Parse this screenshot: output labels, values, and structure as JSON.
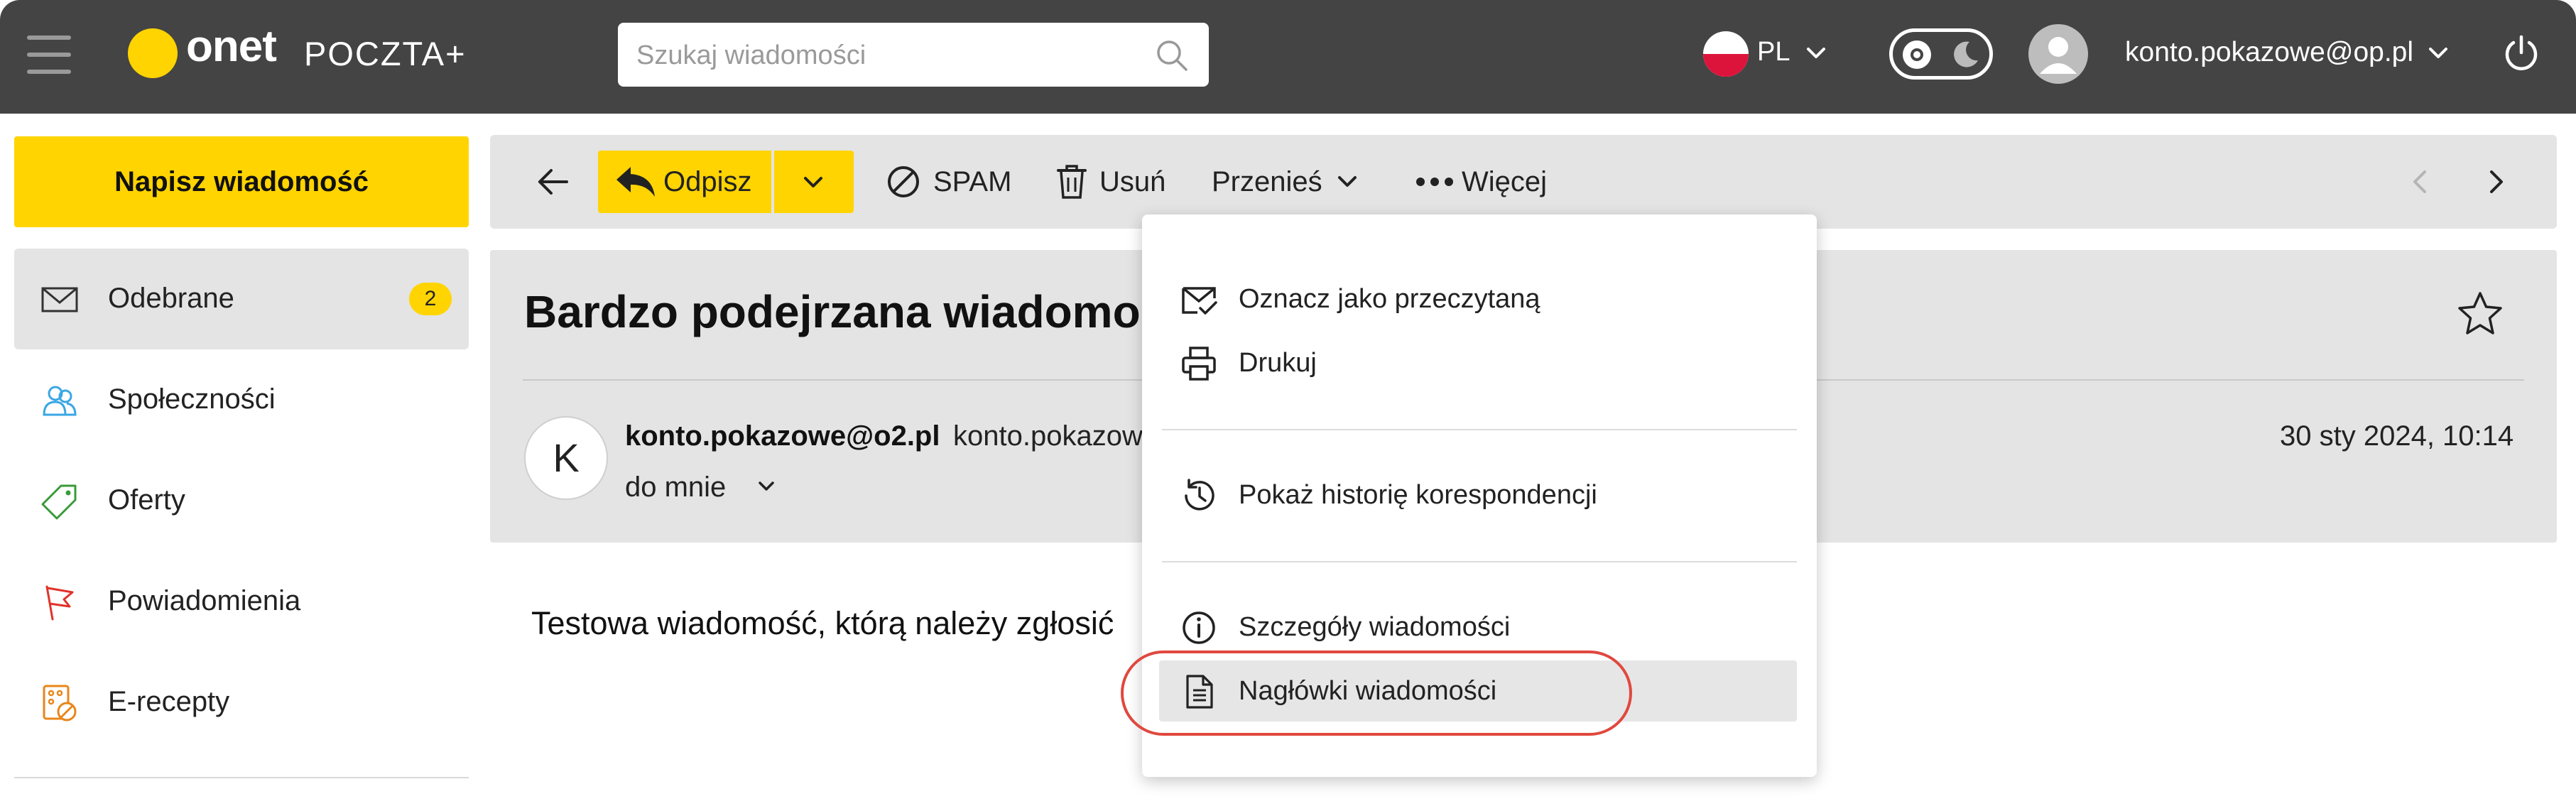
{
  "header": {
    "logo_word": "onet",
    "logo_product": "POCZTA+",
    "search_placeholder": "Szukaj wiadomości",
    "language": "PL",
    "account": "konto.pokazowe@op.pl",
    "icons": [
      "menu-icon",
      "search-icon",
      "pl-flag-icon",
      "chevron-down-icon",
      "theme-toggle-icon",
      "avatar-icon",
      "power-icon"
    ]
  },
  "sidebar": {
    "compose_label": "Napisz wiadomość",
    "items": [
      {
        "label": "Odebrane",
        "badge": "2",
        "icon": "inbox-envelope-icon",
        "active": true
      },
      {
        "label": "Społeczności",
        "icon": "community-people-icon"
      },
      {
        "label": "Oferty",
        "icon": "tag-icon"
      },
      {
        "label": "Powiadomienia",
        "icon": "flag-icon"
      },
      {
        "label": "E-recepty",
        "icon": "prescription-icon"
      }
    ]
  },
  "toolbar": {
    "reply_label": "Odpisz",
    "spam_label": "SPAM",
    "delete_label": "Usuń",
    "move_label": "Przenieś",
    "more_label": "Więcej"
  },
  "message": {
    "subject": "Bardzo podejrzana wiadomość",
    "sender_initial": "K",
    "sender_email": "konto.pokazowe@o2.pl",
    "sender_alias": "konto.pokazow",
    "recipient": "do mnie",
    "date": "30 sty 2024, 10:14",
    "body": "Testowa wiadomość, którą należy zgłosić"
  },
  "more_menu": {
    "items": [
      {
        "label": "Oznacz jako przeczytaną",
        "icon": "mail-check-icon"
      },
      {
        "label": "Drukuj",
        "icon": "printer-icon"
      },
      {
        "label": "Pokaż historię korespondencji",
        "icon": "history-icon"
      },
      {
        "label": "Szczegóły wiadomości",
        "icon": "info-icon"
      },
      {
        "label": "Nagłówki wiadomości",
        "icon": "document-icon",
        "highlighted": true
      }
    ]
  },
  "colors": {
    "accent": "#ffd400",
    "topbar": "#444444",
    "panel": "#e4e4e4",
    "highlight_ring": "#e0483e"
  }
}
